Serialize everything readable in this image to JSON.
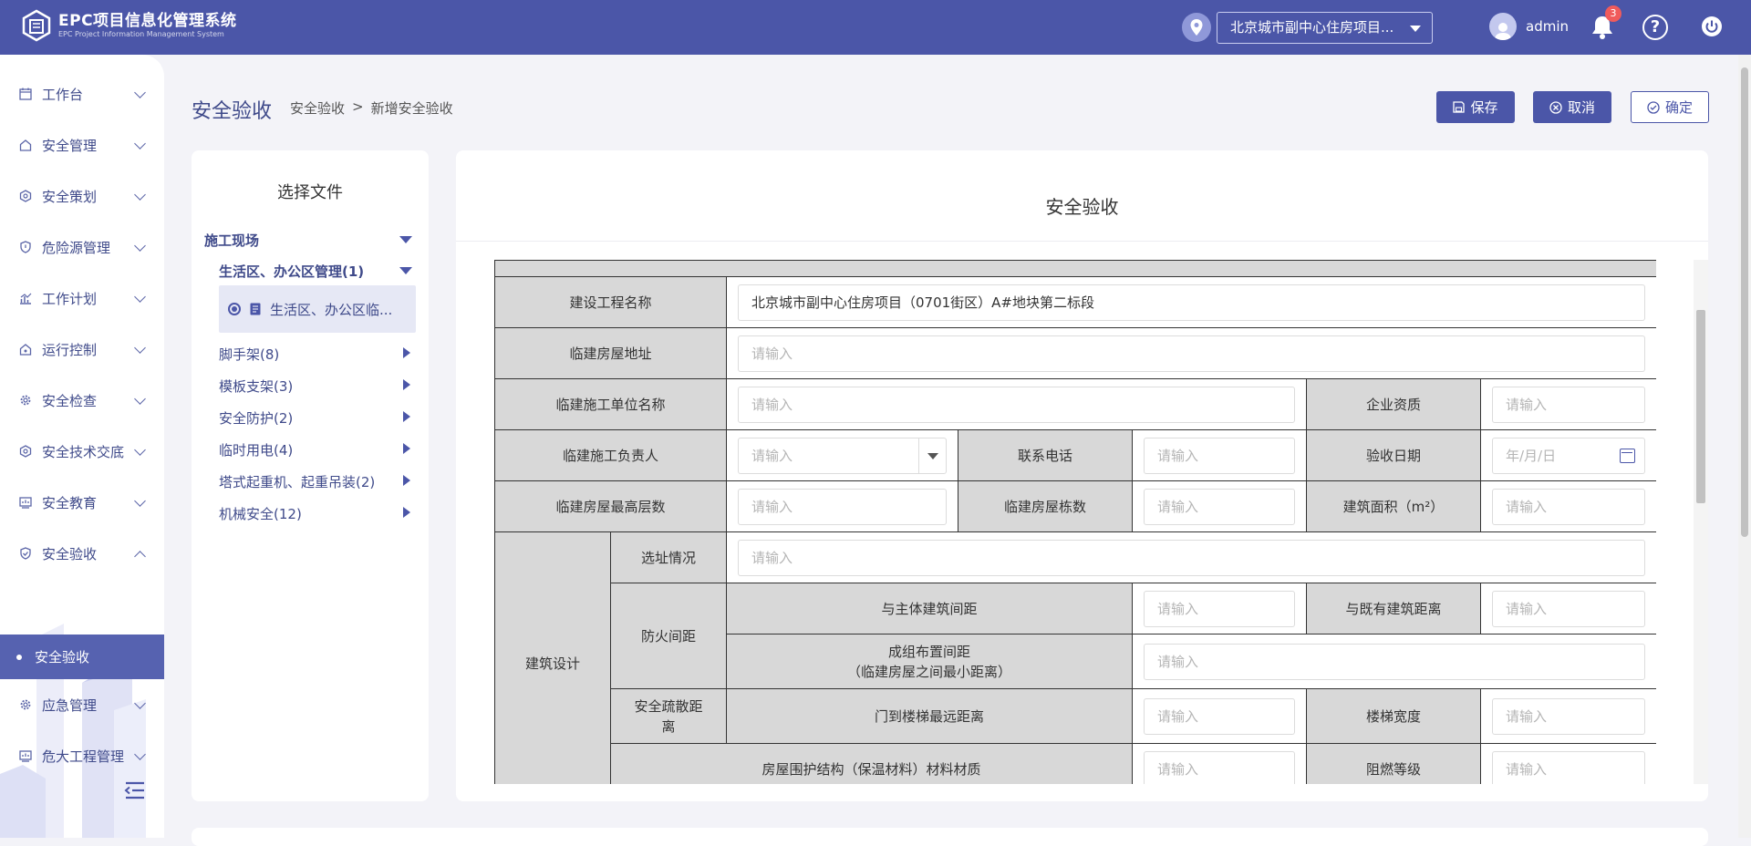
{
  "app": {
    "title": "EPC项目信息化管理系统",
    "subtitle": "EPC Project Information Management System"
  },
  "header": {
    "project": "北京城市副中心住房项目...",
    "user": "admin",
    "notifications": "3",
    "help": "?"
  },
  "sidebar": {
    "items": [
      {
        "label": "工作台",
        "icon": "calendar-icon"
      },
      {
        "label": "安全管理",
        "icon": "home-icon"
      },
      {
        "label": "安全策划",
        "icon": "hexagon-icon"
      },
      {
        "label": "危险源管理",
        "icon": "shield-icon"
      },
      {
        "label": "工作计划",
        "icon": "chart-icon"
      },
      {
        "label": "运行控制",
        "icon": "home-icon"
      },
      {
        "label": "安全检查",
        "icon": "gear-icon"
      },
      {
        "label": "安全技术交底",
        "icon": "hexagon-icon"
      },
      {
        "label": "安全教育",
        "icon": "monitor-icon"
      },
      {
        "label": "安全验收",
        "icon": "check-shield-icon"
      },
      {
        "label": "应急管理",
        "icon": "gear-icon"
      },
      {
        "label": "危大工程管理",
        "icon": "monitor-icon"
      }
    ],
    "active_sub": "安全验收"
  },
  "page": {
    "title": "安全验收",
    "breadcrumb": [
      "安全验收",
      ">",
      "新增安全验收"
    ],
    "buttons": {
      "save": "保存",
      "cancel": "取消",
      "ok": "确定"
    }
  },
  "files": {
    "title": "选择文件",
    "root": "施工现场",
    "group": "生活区、办公区管理(1)",
    "selected_file": "生活区、办公区临...",
    "categories": [
      "脚手架(8)",
      "模板支架(3)",
      "安全防护(2)",
      "临时用电(4)",
      "塔式起重机、起重吊装(2)",
      "机械安全(12)"
    ]
  },
  "form": {
    "title": "安全验收",
    "placeholder": "请输入",
    "date_placeholder": "年/月/日",
    "project_name_value": "北京城市副中心住房项目（0701街区）A#地块第二标段",
    "labels": {
      "project_name": "建设工程名称",
      "address": "临建房屋地址",
      "unit": "临建施工单位名称",
      "qualification": "企业资质",
      "leader": "临建施工负责人",
      "phone": "联系电话",
      "date": "验收日期",
      "floors": "临建房屋最高层数",
      "count": "临建房屋栋数",
      "area": "建筑面积（m²）",
      "design": "建筑设计",
      "site": "选址情况",
      "fire": "防火间距",
      "main_dist": "与主体建筑间距",
      "exist_dist": "与既有建筑距离",
      "group_dist_1": "成组布置间距",
      "group_dist_2": "（临建房屋之间最小距离）",
      "evac_1": "安全疏散距",
      "evac_2": "离",
      "door_dist": "门到楼梯最远距离",
      "stair_width": "楼梯宽度",
      "envelope": "房屋围护结构（保温材料）材料材质",
      "flame": "阻燃等级"
    }
  },
  "colors": {
    "primary": "#4b56a8",
    "label_bg": "#d8d8d8",
    "badge": "#f05b5b"
  }
}
